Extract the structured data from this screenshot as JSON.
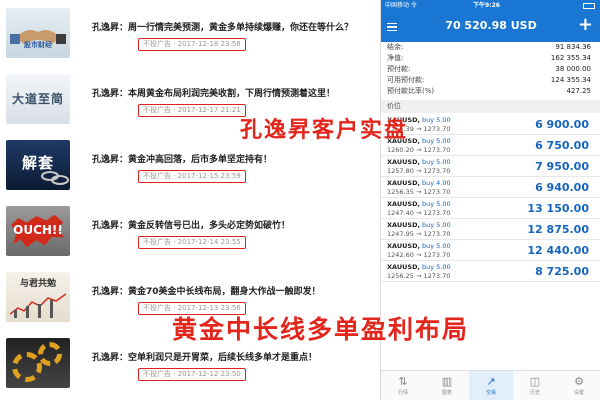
{
  "feed": {
    "posts": [
      {
        "thumb_text": "股市财经",
        "title": "孔逸昇：周一行情完美预测，黄金多单持续爆赚，你还在等什么？",
        "stamp": "不投广告 · 2017-12-18 23:58"
      },
      {
        "thumb_text": "大道至简",
        "title": "孔逸昇：本周黄金布局利润完美收割，下周行情预测着这里！",
        "stamp": "不投广告 · 2017-12-17 21:21"
      },
      {
        "thumb_text": "解套",
        "title": "孔逸昇：黄金冲高回落，后市多单坚定持有！",
        "stamp": "不投广告 · 2017-12-15 23:59"
      },
      {
        "thumb_text": "OUCH!!",
        "title": "孔逸昇：黄金反转信号已出，多头必定势如破竹！",
        "stamp": "不投广告 · 2017-12-14 23:55"
      },
      {
        "thumb_text": "与君共勉",
        "title": "孔逸昇：黄金70美金中长线布局，翻身大作战一触即发！",
        "stamp": "不投广告 · 2017-12-13 23:56"
      },
      {
        "thumb_text": "",
        "title": "孔逸昇：空单利润只是开胃菜，后续长线多单才是重点！",
        "stamp": "不投广告 · 2017-12-12 23:50"
      }
    ]
  },
  "phone": {
    "status": {
      "carrier": "中国移动 令",
      "time": "下午9:26"
    },
    "header": {
      "balance": "70 520.98 USD",
      "add": "+"
    },
    "account": [
      {
        "label": "结余:",
        "value": "91 834.36"
      },
      {
        "label": "净值:",
        "value": "162 355.34"
      },
      {
        "label": "预付款:",
        "value": "38 000.00"
      },
      {
        "label": "可用预付款:",
        "value": "124 355.34"
      },
      {
        "label": "预付款比率(%)",
        "value": "427.25"
      }
    ],
    "section_label": "价位",
    "orders": [
      {
        "symbol": "XAUUSD,",
        "side": "buy 5.00",
        "prices": "1256.39 → 1273.70",
        "profit": "6 900.00"
      },
      {
        "symbol": "XAUUSD,",
        "side": "buy 5.00",
        "prices": "1260.20 → 1273.70",
        "profit": "6 750.00"
      },
      {
        "symbol": "XAUUSD,",
        "side": "buy 5.00",
        "prices": "1257.80 → 1273.70",
        "profit": "7 950.00"
      },
      {
        "symbol": "XAUUSD,",
        "side": "buy 4.00",
        "prices": "1256.35 → 1273.70",
        "profit": "6 940.00"
      },
      {
        "symbol": "XAUUSD,",
        "side": "buy 5.00",
        "prices": "1247.40 → 1273.70",
        "profit": "13 150.00"
      },
      {
        "symbol": "XAUUSD,",
        "side": "buy 5.00",
        "prices": "1247.95 → 1273.70",
        "profit": "12 875.00"
      },
      {
        "symbol": "XAUUSD,",
        "side": "buy 5.00",
        "prices": "1242.60 → 1273.70",
        "profit": "12 440.00"
      },
      {
        "symbol": "XAUUSD,",
        "side": "buy 5.00",
        "prices": "1256.25 → 1273.70",
        "profit": "8 725.00"
      }
    ],
    "tabs": [
      {
        "label": "行情",
        "icon": "quotes-icon",
        "glyph": "⇅"
      },
      {
        "label": "图表",
        "icon": "chart-icon",
        "glyph": "▥"
      },
      {
        "label": "交易",
        "icon": "trade-icon",
        "glyph": "↗"
      },
      {
        "label": "历史",
        "icon": "history-icon",
        "glyph": "◫"
      },
      {
        "label": "设置",
        "icon": "settings-icon",
        "glyph": "⚙"
      }
    ],
    "active_tab": 2
  },
  "overlays": {
    "top": "孔逸昇客户实盘",
    "bottom": "黄金中长线多单盈利布局"
  },
  "colors": {
    "accent": "#1976d2",
    "profit": "#1565c0",
    "stamp_border": "#e02020",
    "overlay": "#e3251b"
  }
}
